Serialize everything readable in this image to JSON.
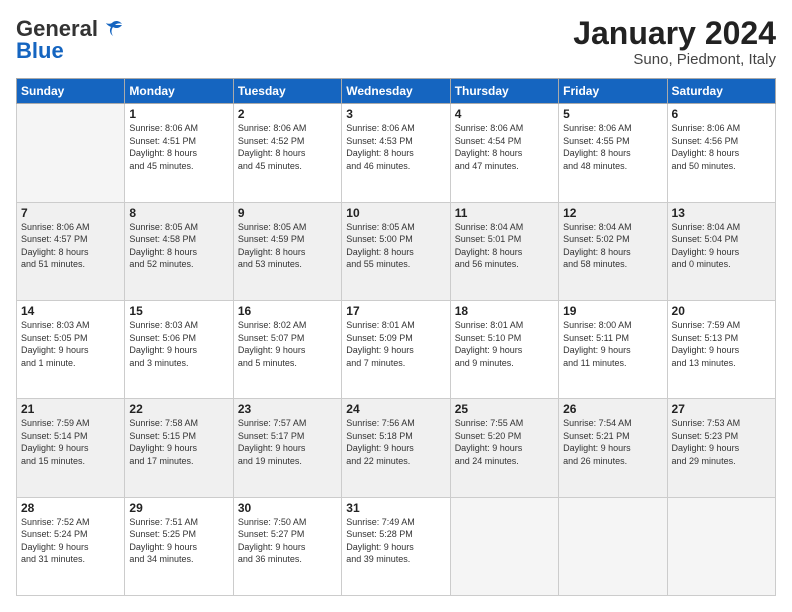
{
  "header": {
    "logo_general": "General",
    "logo_blue": "Blue",
    "month_title": "January 2024",
    "subtitle": "Suno, Piedmont, Italy"
  },
  "days_of_week": [
    "Sunday",
    "Monday",
    "Tuesday",
    "Wednesday",
    "Thursday",
    "Friday",
    "Saturday"
  ],
  "weeks": [
    [
      {
        "day": "",
        "info": ""
      },
      {
        "day": "1",
        "info": "Sunrise: 8:06 AM\nSunset: 4:51 PM\nDaylight: 8 hours\nand 45 minutes."
      },
      {
        "day": "2",
        "info": "Sunrise: 8:06 AM\nSunset: 4:52 PM\nDaylight: 8 hours\nand 45 minutes."
      },
      {
        "day": "3",
        "info": "Sunrise: 8:06 AM\nSunset: 4:53 PM\nDaylight: 8 hours\nand 46 minutes."
      },
      {
        "day": "4",
        "info": "Sunrise: 8:06 AM\nSunset: 4:54 PM\nDaylight: 8 hours\nand 47 minutes."
      },
      {
        "day": "5",
        "info": "Sunrise: 8:06 AM\nSunset: 4:55 PM\nDaylight: 8 hours\nand 48 minutes."
      },
      {
        "day": "6",
        "info": "Sunrise: 8:06 AM\nSunset: 4:56 PM\nDaylight: 8 hours\nand 50 minutes."
      }
    ],
    [
      {
        "day": "7",
        "info": "Sunrise: 8:06 AM\nSunset: 4:57 PM\nDaylight: 8 hours\nand 51 minutes."
      },
      {
        "day": "8",
        "info": "Sunrise: 8:05 AM\nSunset: 4:58 PM\nDaylight: 8 hours\nand 52 minutes."
      },
      {
        "day": "9",
        "info": "Sunrise: 8:05 AM\nSunset: 4:59 PM\nDaylight: 8 hours\nand 53 minutes."
      },
      {
        "day": "10",
        "info": "Sunrise: 8:05 AM\nSunset: 5:00 PM\nDaylight: 8 hours\nand 55 minutes."
      },
      {
        "day": "11",
        "info": "Sunrise: 8:04 AM\nSunset: 5:01 PM\nDaylight: 8 hours\nand 56 minutes."
      },
      {
        "day": "12",
        "info": "Sunrise: 8:04 AM\nSunset: 5:02 PM\nDaylight: 8 hours\nand 58 minutes."
      },
      {
        "day": "13",
        "info": "Sunrise: 8:04 AM\nSunset: 5:04 PM\nDaylight: 9 hours\nand 0 minutes."
      }
    ],
    [
      {
        "day": "14",
        "info": "Sunrise: 8:03 AM\nSunset: 5:05 PM\nDaylight: 9 hours\nand 1 minute."
      },
      {
        "day": "15",
        "info": "Sunrise: 8:03 AM\nSunset: 5:06 PM\nDaylight: 9 hours\nand 3 minutes."
      },
      {
        "day": "16",
        "info": "Sunrise: 8:02 AM\nSunset: 5:07 PM\nDaylight: 9 hours\nand 5 minutes."
      },
      {
        "day": "17",
        "info": "Sunrise: 8:01 AM\nSunset: 5:09 PM\nDaylight: 9 hours\nand 7 minutes."
      },
      {
        "day": "18",
        "info": "Sunrise: 8:01 AM\nSunset: 5:10 PM\nDaylight: 9 hours\nand 9 minutes."
      },
      {
        "day": "19",
        "info": "Sunrise: 8:00 AM\nSunset: 5:11 PM\nDaylight: 9 hours\nand 11 minutes."
      },
      {
        "day": "20",
        "info": "Sunrise: 7:59 AM\nSunset: 5:13 PM\nDaylight: 9 hours\nand 13 minutes."
      }
    ],
    [
      {
        "day": "21",
        "info": "Sunrise: 7:59 AM\nSunset: 5:14 PM\nDaylight: 9 hours\nand 15 minutes."
      },
      {
        "day": "22",
        "info": "Sunrise: 7:58 AM\nSunset: 5:15 PM\nDaylight: 9 hours\nand 17 minutes."
      },
      {
        "day": "23",
        "info": "Sunrise: 7:57 AM\nSunset: 5:17 PM\nDaylight: 9 hours\nand 19 minutes."
      },
      {
        "day": "24",
        "info": "Sunrise: 7:56 AM\nSunset: 5:18 PM\nDaylight: 9 hours\nand 22 minutes."
      },
      {
        "day": "25",
        "info": "Sunrise: 7:55 AM\nSunset: 5:20 PM\nDaylight: 9 hours\nand 24 minutes."
      },
      {
        "day": "26",
        "info": "Sunrise: 7:54 AM\nSunset: 5:21 PM\nDaylight: 9 hours\nand 26 minutes."
      },
      {
        "day": "27",
        "info": "Sunrise: 7:53 AM\nSunset: 5:23 PM\nDaylight: 9 hours\nand 29 minutes."
      }
    ],
    [
      {
        "day": "28",
        "info": "Sunrise: 7:52 AM\nSunset: 5:24 PM\nDaylight: 9 hours\nand 31 minutes."
      },
      {
        "day": "29",
        "info": "Sunrise: 7:51 AM\nSunset: 5:25 PM\nDaylight: 9 hours\nand 34 minutes."
      },
      {
        "day": "30",
        "info": "Sunrise: 7:50 AM\nSunset: 5:27 PM\nDaylight: 9 hours\nand 36 minutes."
      },
      {
        "day": "31",
        "info": "Sunrise: 7:49 AM\nSunset: 5:28 PM\nDaylight: 9 hours\nand 39 minutes."
      },
      {
        "day": "",
        "info": ""
      },
      {
        "day": "",
        "info": ""
      },
      {
        "day": "",
        "info": ""
      }
    ]
  ]
}
